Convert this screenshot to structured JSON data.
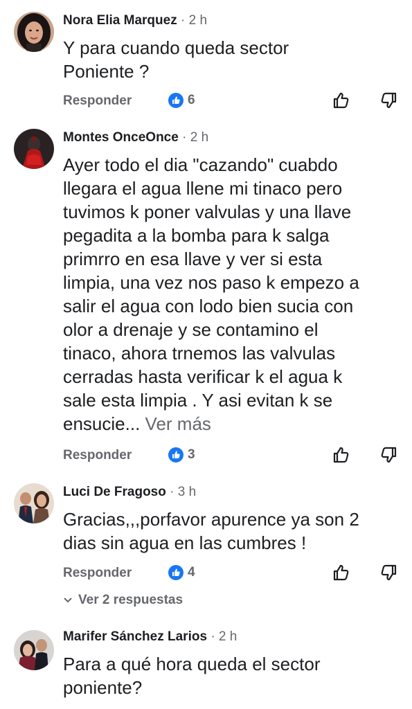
{
  "comments": [
    {
      "author": "Nora Elia Marquez",
      "time": "2 h",
      "text": "Y para cuando queda sector\nPoniente ?",
      "more": "",
      "reply_label": "Responder",
      "likes": "6",
      "avatar_icon": "profile-photo"
    },
    {
      "author": "Montes OnceOnce",
      "time": "2 h",
      "text": "Ayer todo el dia \"cazando\" cuabdo\nllegara el agua llene mi tinaco pero\ntuvimos k poner valvulas y una llave\npegadita a la bomba para k salga\nprimrro en esa llave y ver si esta\nlimpia, una vez nos paso k empezo a\nsalir el agua con lodo bien sucia con\nolor a drenaje  y se contamino el\ntinaco, ahora trnemos las valvulas\ncerradas hasta verificar k el agua k\nsale esta limpia . Y asi evitan k se\nensucie...",
      "more": "Ver más",
      "reply_label": "Responder",
      "likes": "3",
      "avatar_icon": "profile-photo"
    },
    {
      "author": "Luci De Fragoso",
      "time": "3 h",
      "text": "Gracias,,,porfavor apurence ya son 2\ndias sin agua en las cumbres !",
      "more": "",
      "reply_label": "Responder",
      "likes": "4",
      "avatar_icon": "profile-photo"
    },
    {
      "author": "Marifer Sánchez Larios",
      "time": "2 h",
      "text": "Para a qué hora queda el sector\nponiente?",
      "more": "",
      "avatar_icon": "profile-photo"
    }
  ],
  "view_replies": "Ver 2 respuestas",
  "separator": "·",
  "colors": {
    "text": "#1c1e21",
    "secondary": "#65676b",
    "like_blue": "#1877f2"
  }
}
